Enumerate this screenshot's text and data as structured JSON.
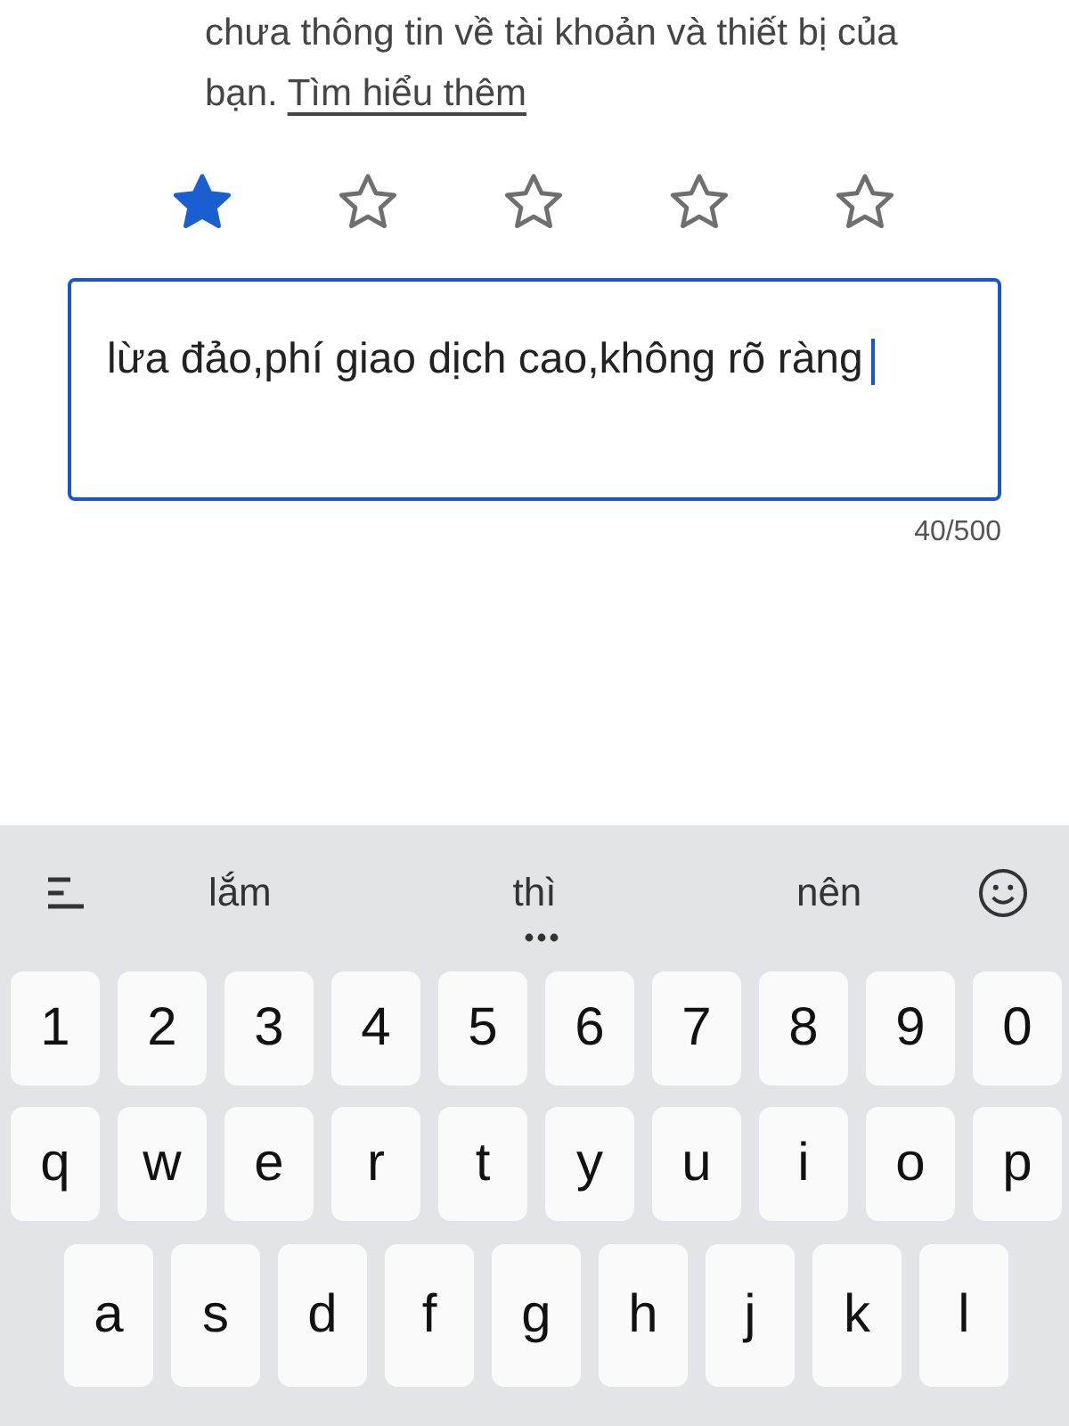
{
  "intro": {
    "text": "chưa thông tin về tài khoản và thiết bị của bạn.",
    "link": "Tìm hiểu thêm"
  },
  "rating": {
    "stars": 1
  },
  "review": {
    "value": "lừa đảo,phí giao dịch cao,không rõ ràng",
    "counter": "40/500"
  },
  "keyboard": {
    "suggestions": [
      "lắm",
      "thì",
      "nên"
    ],
    "rows": [
      [
        "1",
        "2",
        "3",
        "4",
        "5",
        "6",
        "7",
        "8",
        "9",
        "0"
      ],
      [
        "q",
        "w",
        "e",
        "r",
        "t",
        "y",
        "u",
        "i",
        "o",
        "p"
      ],
      [
        "a",
        "s",
        "d",
        "f",
        "g",
        "h",
        "j",
        "k",
        "l"
      ]
    ]
  }
}
